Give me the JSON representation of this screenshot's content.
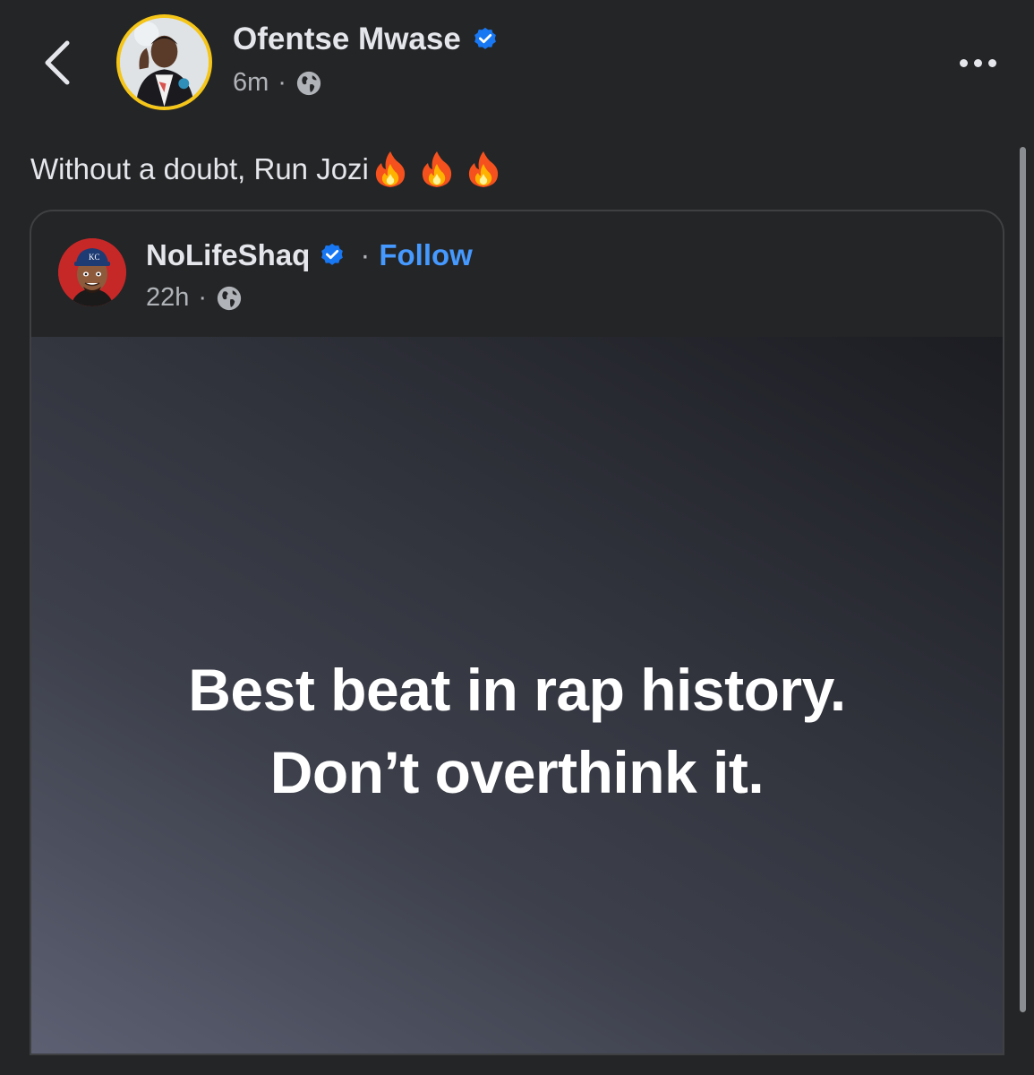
{
  "header": {
    "author_name": "Ofentse Mwase",
    "time_ago": "6m",
    "separator": "·",
    "audience_icon": "globe-icon",
    "verified_icon": "verified-badge-icon",
    "ring_color": "#f5c518"
  },
  "post": {
    "text": "Without a doubt, Run Jozi",
    "emoji": [
      "🔥",
      "🔥",
      "🔥"
    ]
  },
  "shared_post": {
    "author_name": "NoLifeShaq",
    "separator": "·",
    "follow_label": "Follow",
    "time_ago": "22h",
    "quote_lines": [
      "Best beat in rap history.",
      "Don’t overthink it."
    ]
  },
  "colors": {
    "background": "#242526",
    "text": "#e4e6eb",
    "secondary_text": "#b0b3b8",
    "link": "#4599ff",
    "verified": "#1877f2"
  }
}
